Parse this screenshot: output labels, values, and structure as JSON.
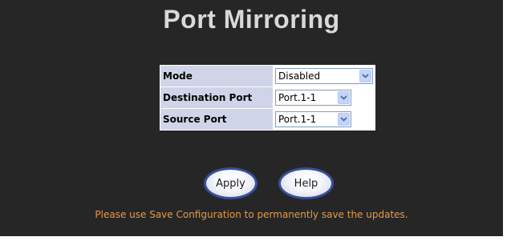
{
  "page": {
    "title": "Port Mirroring",
    "note": "Please use Save Configuration to permanently save the updates."
  },
  "settings": {
    "mode": {
      "label": "Mode",
      "value": "Disabled"
    },
    "destination_port": {
      "label": "Destination Port",
      "value": "Port.1-1"
    },
    "source_port": {
      "label": "Source Port",
      "value": "Port.1-1"
    }
  },
  "buttons": {
    "apply": "Apply",
    "help": "Help"
  },
  "icons": {
    "dropdown": "chevron-down-icon"
  },
  "colors": {
    "panel_background": "#262626",
    "title": "#d9d9d9",
    "label_cell": "#d0d4e8",
    "note_text": "#e39a4a",
    "button_border": "#3a4e9a"
  }
}
